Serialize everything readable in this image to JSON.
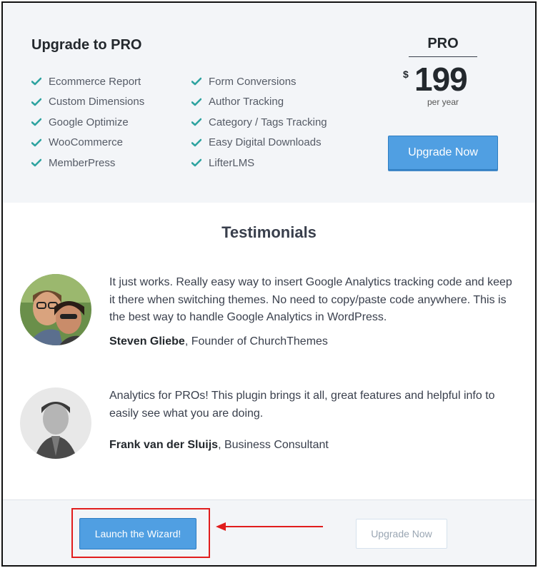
{
  "pro": {
    "title": "Upgrade to PRO",
    "features_col1": [
      "Ecommerce Report",
      "Custom Dimensions",
      "Google Optimize",
      "WooCommerce",
      "MemberPress"
    ],
    "features_col2": [
      "Form Conversions",
      "Author Tracking",
      "Category / Tags Tracking",
      "Easy Digital Downloads",
      "LifterLMS"
    ],
    "plan_label": "PRO",
    "currency": "$",
    "price": "199",
    "period": "per year",
    "upgrade_label": "Upgrade Now",
    "check_color": "#2ea3a0"
  },
  "testimonials": {
    "title": "Testimonials",
    "items": [
      {
        "quote": "It just works. Really easy way to insert Google Analytics tracking code and keep it there when switching themes. No need to copy/paste code anywhere. This is the best way to handle Google Analytics in WordPress.",
        "name": "Steven Gliebe",
        "role": ", Founder of ChurchThemes"
      },
      {
        "quote": "Analytics for PROs! This plugin brings it all, great features and helpful info to easily see what you are doing.",
        "name": "Frank van der Sluijs",
        "role": ", Business Consultant"
      }
    ]
  },
  "footer": {
    "wizard_label": "Launch the Wizard!",
    "upgrade_label": "Upgrade Now",
    "highlight_color": "#e11d1d"
  }
}
